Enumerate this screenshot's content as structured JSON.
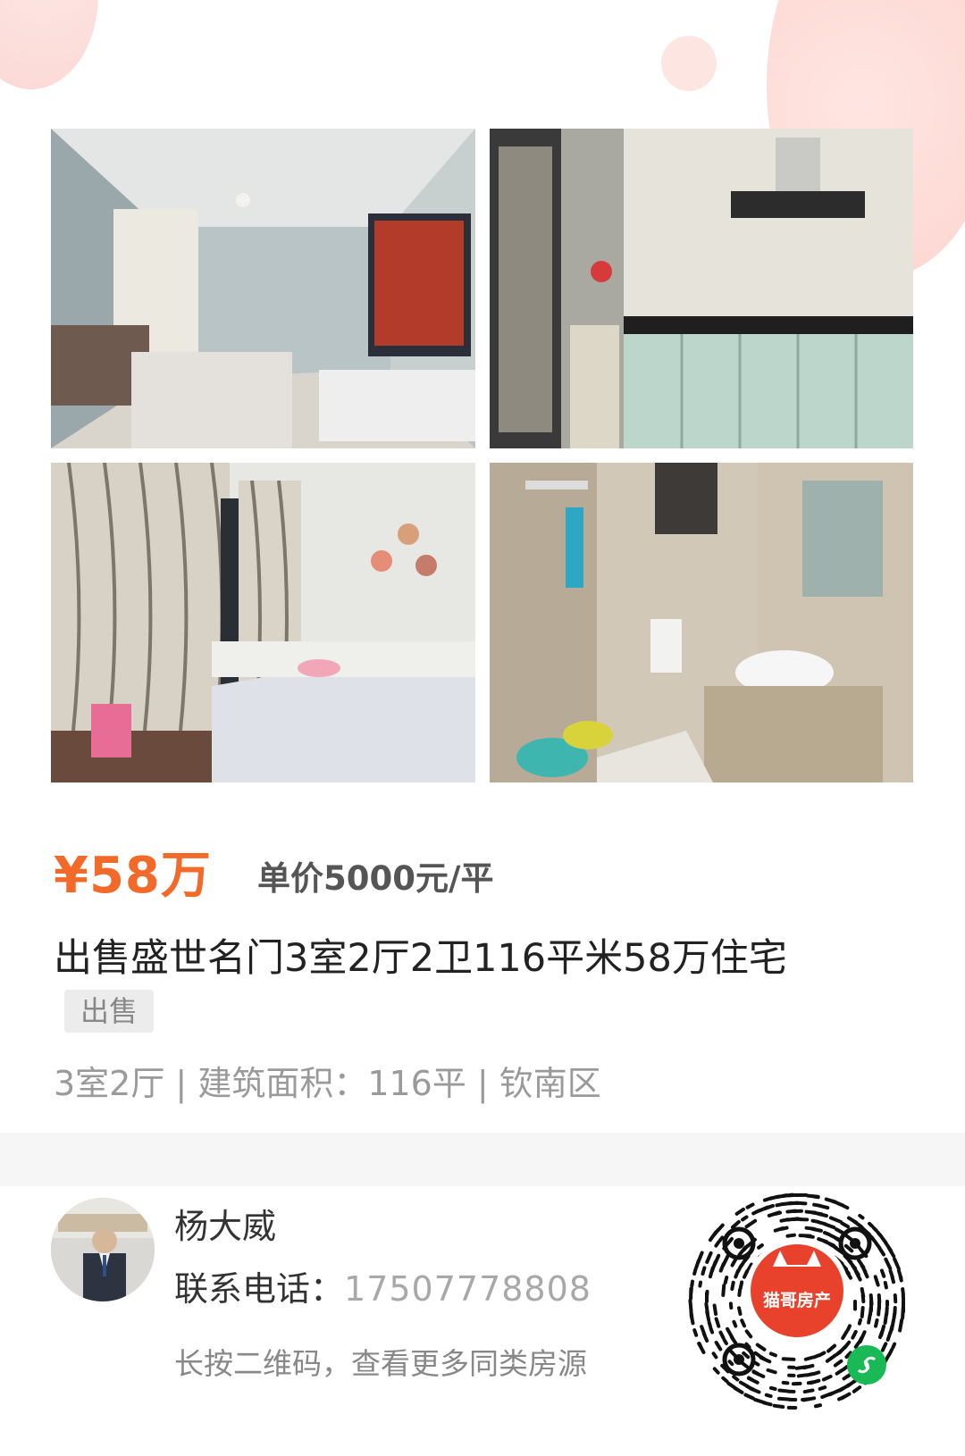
{
  "listing": {
    "price": "¥58万",
    "unit_price": "单价5000元/平",
    "title": "出售盛世名门3室2厅2卫116平米58万住宅",
    "tag": "出售",
    "meta": "3室2厅 | 建筑面积：116平 | 钦南区"
  },
  "photos": [
    {
      "icon": "living-room-photo"
    },
    {
      "icon": "kitchen-photo"
    },
    {
      "icon": "bedroom-photo"
    },
    {
      "icon": "bathroom-photo"
    }
  ],
  "agent": {
    "name": "杨大威",
    "phone_label": "联系电话：",
    "phone": "17507778808",
    "hint": "长按二维码，查看更多同类房源"
  },
  "qr": {
    "brand": "猫哥房产",
    "brand_color": "#e8412c"
  },
  "colors": {
    "accent": "#f26a2a",
    "decor_pink": "#fcd0ca"
  }
}
